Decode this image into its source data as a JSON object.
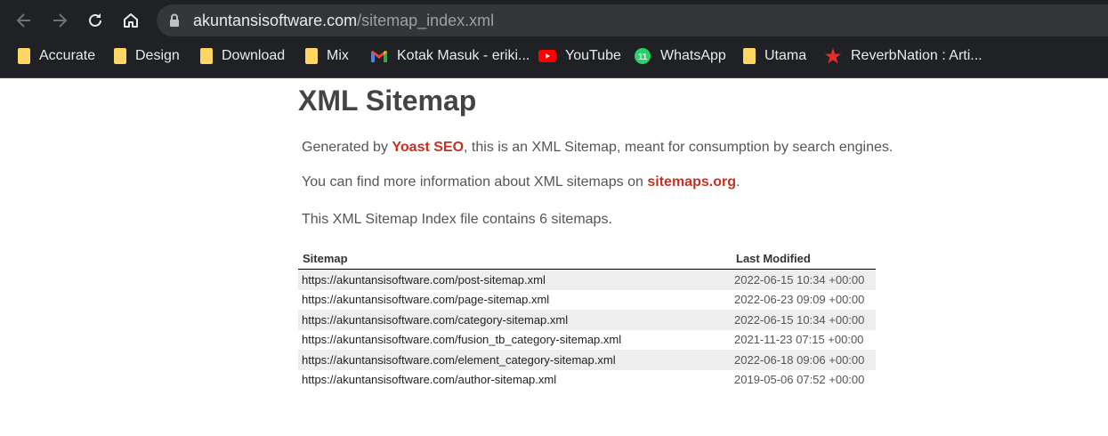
{
  "browser": {
    "url_host": "akuntansisoftware.com",
    "url_path": "/sitemap_index.xml",
    "bookmarks": [
      {
        "label": "Accurate",
        "icon": "folder-icon"
      },
      {
        "label": "Design",
        "icon": "folder-icon"
      },
      {
        "label": "Download",
        "icon": "folder-icon"
      },
      {
        "label": "Mix",
        "icon": "folder-icon"
      },
      {
        "label": "Kotak Masuk - eriki...",
        "icon": "gmail-icon"
      },
      {
        "label": "YouTube",
        "icon": "youtube-icon"
      },
      {
        "label": "WhatsApp",
        "icon": "whatsapp-icon"
      },
      {
        "label": "Utama",
        "icon": "folder-icon"
      },
      {
        "label": "ReverbNation : Arti...",
        "icon": "star-icon"
      }
    ]
  },
  "page": {
    "title": "XML Sitemap",
    "line1_pre": "Generated by ",
    "line1_link": "Yoast SEO",
    "line1_post": ", this is an XML Sitemap, meant for consumption by search engines.",
    "line2_pre": "You can find more information about XML sitemaps on ",
    "line2_link": "sitemaps.org",
    "line2_post": ".",
    "line3": "This XML Sitemap Index file contains 6 sitemaps.",
    "link_color": "#c53225"
  },
  "table": {
    "headers": [
      "Sitemap",
      "Last Modified"
    ],
    "rows": [
      {
        "url": "https://akuntansisoftware.com/post-sitemap.xml",
        "modified": "2022-06-15 10:34 +00:00"
      },
      {
        "url": "https://akuntansisoftware.com/page-sitemap.xml",
        "modified": "2022-06-23 09:09 +00:00"
      },
      {
        "url": "https://akuntansisoftware.com/category-sitemap.xml",
        "modified": "2022-06-15 10:34 +00:00"
      },
      {
        "url": "https://akuntansisoftware.com/fusion_tb_category-sitemap.xml",
        "modified": "2021-11-23 07:15 +00:00"
      },
      {
        "url": "https://akuntansisoftware.com/element_category-sitemap.xml",
        "modified": "2022-06-18 09:06 +00:00"
      },
      {
        "url": "https://akuntansisoftware.com/author-sitemap.xml",
        "modified": "2019-05-06 07:52 +00:00"
      }
    ]
  }
}
